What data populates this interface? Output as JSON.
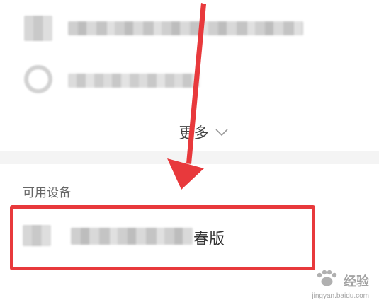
{
  "list": {
    "more_label": "更多"
  },
  "available_devices": {
    "section_title": "可用设备",
    "device_name_suffix": "春版"
  },
  "annotations": {
    "arrow_color": "#e8393c",
    "highlight_color": "#e8393c"
  },
  "watermark": {
    "brand": "经验",
    "url": "jingyan.baidu.com"
  },
  "icons": {
    "more_chevron": "chevron-down-icon",
    "watermark_logo": "baidu-paw-icon"
  }
}
